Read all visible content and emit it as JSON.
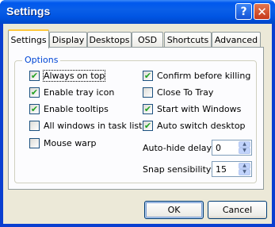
{
  "window": {
    "title": "Settings",
    "help_glyph": "?",
    "close_glyph": "✕"
  },
  "tabs": [
    {
      "label": "Settings",
      "active": true
    },
    {
      "label": "Display"
    },
    {
      "label": "Desktops"
    },
    {
      "label": "OSD"
    },
    {
      "label": "Shortcuts"
    },
    {
      "label": "Advanced"
    }
  ],
  "options": {
    "legend": "Options",
    "left": [
      {
        "label": "Always on top",
        "checked": true
      },
      {
        "label": "Enable tray icon",
        "checked": true
      },
      {
        "label": "Enable tooltips",
        "checked": true
      },
      {
        "label": "All windows in task list",
        "checked": false
      },
      {
        "label": "Mouse warp",
        "checked": false
      }
    ],
    "right": [
      {
        "label": "Confirm before killing",
        "checked": true
      },
      {
        "label": "Close To Tray",
        "checked": false
      },
      {
        "label": "Start with Windows",
        "checked": true
      },
      {
        "label": "Auto switch desktop",
        "checked": true
      }
    ],
    "autohide": {
      "label": "Auto-hide delay:",
      "value": "0"
    },
    "snap": {
      "label": "Snap sensibility:",
      "value": "15"
    }
  },
  "buttons": {
    "ok": "OK",
    "cancel": "Cancel"
  },
  "colors": {
    "titlebar": "#0058ee",
    "face": "#ece9d8",
    "check": "#21a121",
    "legend": "#0046d5"
  }
}
